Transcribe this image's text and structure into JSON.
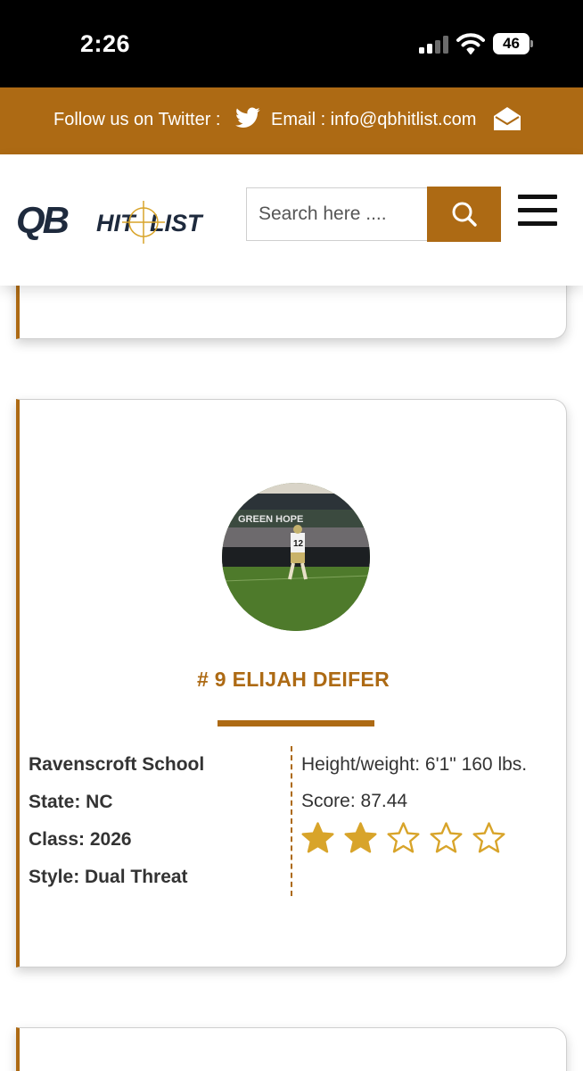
{
  "status_bar": {
    "time": "2:26",
    "battery": "46"
  },
  "topbar": {
    "twitter_label": "Follow us on Twitter :",
    "email_label": "Email : info@qbhitlist.com"
  },
  "header": {
    "logo_text_qb": "QB",
    "logo_text_hit": "HIT",
    "logo_text_list": "LIST",
    "search_placeholder": "Search here ...."
  },
  "player": {
    "name": "# 9 ELIJAH DEIFER",
    "photo_text_banner": "GREEN HOPE",
    "photo_jersey_number": "12",
    "school": "Ravenscroft School",
    "state": "State: NC",
    "class": "Class: 2026",
    "style": "Style: Dual Threat",
    "height_weight": "Height/weight: 6'1\" 160 lbs.",
    "score": "Score: 87.44",
    "rating": {
      "filled": 2,
      "total": 5
    }
  },
  "colors": {
    "accent": "#ad6a14",
    "star": "#d8a42a"
  },
  "icons": [
    "twitter-icon",
    "envelope-icon",
    "search-icon",
    "hamburger-menu-icon",
    "star-icon"
  ]
}
